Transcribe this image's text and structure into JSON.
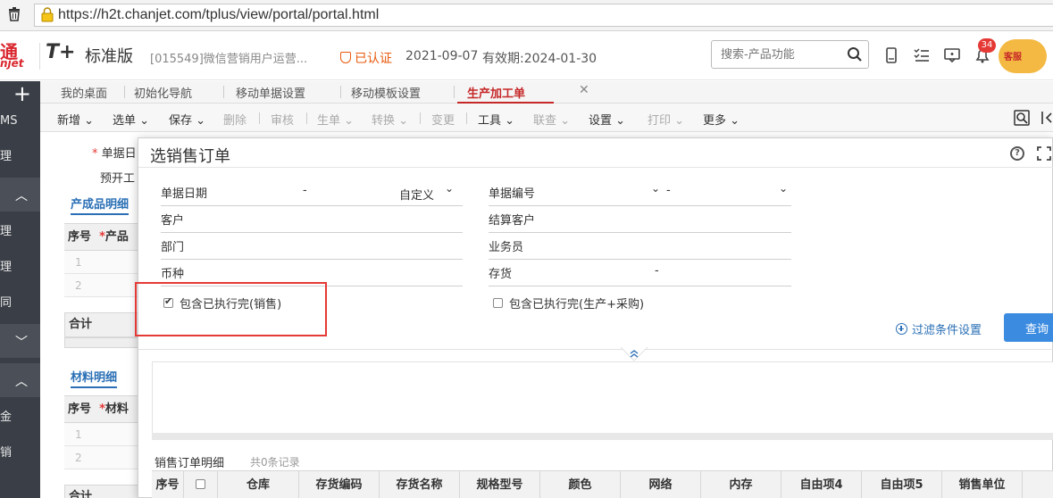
{
  "browser": {
    "url": "https://h2t.chanjet.com/tplus/view/portal/portal.html"
  },
  "header": {
    "logo_text_top": "通",
    "logo_text_bottom": "njet",
    "product": "T+",
    "edition": "标准版",
    "company": "[015549]微信营销用户运营...",
    "verified": "已认证",
    "start_date": "2021-09-07",
    "valid_until": "有效期:2024-01-30",
    "search_placeholder": "搜索-产品功能",
    "notification_count": "34",
    "service_label": "客服"
  },
  "sidebar": {
    "plus": "+",
    "items": [
      "MS",
      "理",
      "理",
      "理",
      "同",
      "金",
      "销"
    ]
  },
  "tabs": [
    {
      "label": "我的桌面"
    },
    {
      "label": "初始化导航"
    },
    {
      "label": "移动单据设置"
    },
    {
      "label": "移动模板设置"
    },
    {
      "label": "生产加工单",
      "active": true
    }
  ],
  "toolbar": [
    {
      "label": "新增",
      "dropdown": true
    },
    {
      "label": "选单",
      "dropdown": true
    },
    {
      "label": "保存",
      "dropdown": true
    },
    {
      "label": "删除",
      "disabled": true
    },
    {
      "label": "审核",
      "disabled": true
    },
    {
      "label": "生单",
      "dropdown": true,
      "disabled": true
    },
    {
      "label": "转换",
      "dropdown": true,
      "disabled": true
    },
    {
      "label": "变更",
      "disabled": true
    },
    {
      "label": "工具",
      "dropdown": true
    },
    {
      "label": "联查",
      "dropdown": true,
      "disabled": true
    },
    {
      "label": "设置",
      "dropdown": true
    },
    {
      "label": "打印",
      "dropdown": true,
      "disabled": true
    },
    {
      "label": "更多",
      "dropdown": true
    }
  ],
  "background_form": {
    "doc_date_label": "单据日",
    "pre_open_label": "预开工",
    "product_detail": "产成品明细",
    "material_detail": "材料明细",
    "col_seq": "序号",
    "col_product": "产品",
    "col_material": "材料",
    "total": "合计",
    "rows": [
      "1",
      "2"
    ]
  },
  "dialog": {
    "title": "选销售订单",
    "help": "?",
    "fields": {
      "doc_date": {
        "label": "单据日期",
        "sep": "-",
        "mode": "自定义"
      },
      "doc_no": {
        "label": "单据编号",
        "sep": "-"
      },
      "customer": {
        "label": "客户"
      },
      "settle_customer": {
        "label": "结算客户"
      },
      "department": {
        "label": "部门"
      },
      "salesman": {
        "label": "业务员"
      },
      "currency": {
        "label": "币种"
      },
      "inventory": {
        "label": "存货",
        "sep": "-"
      }
    },
    "checkbox_sales": {
      "label": "包含已执行完(销售)",
      "checked": true
    },
    "checkbox_prod": {
      "label": "包含已执行完(生产+采购)",
      "checked": false
    },
    "filter_link": "过滤条件设置",
    "query_button": "查询",
    "detail_title": "销售订单明细",
    "detail_count": "共0条记录",
    "columns": [
      "序号",
      "仓库",
      "存货编码",
      "存货名称",
      "规格型号",
      "颜色",
      "网络",
      "内存",
      "自由项4",
      "自由项5",
      "销售单位"
    ]
  },
  "colors": {
    "accent_red": "#c62828",
    "link_blue": "#2a6fb5",
    "button_blue": "#3b8be0",
    "sidebar_bg": "#3a3f47",
    "highlight_box": "#e53935"
  }
}
